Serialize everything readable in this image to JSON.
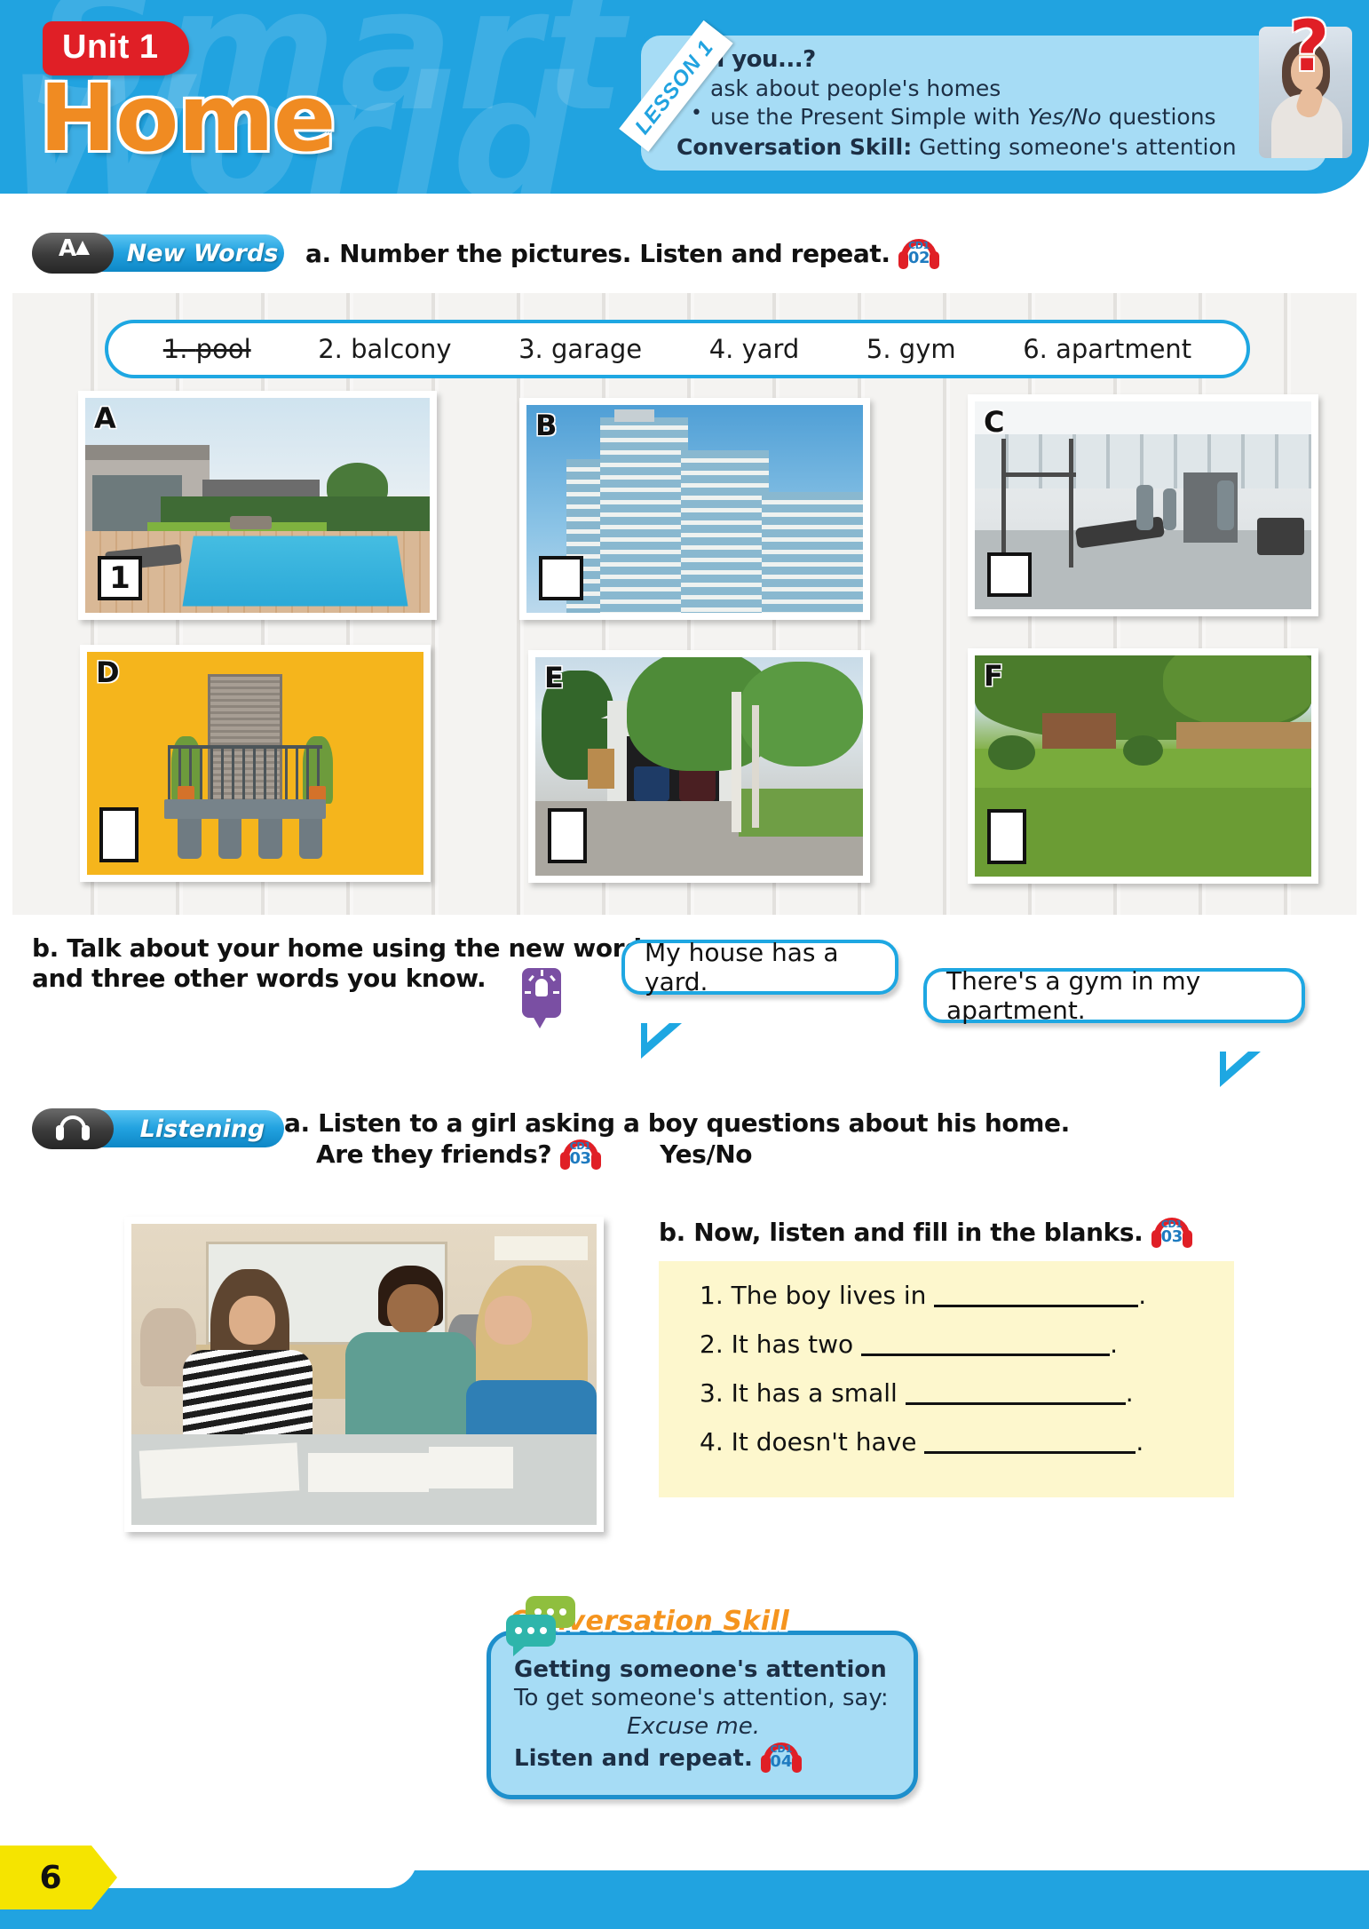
{
  "header": {
    "unit_label": "Unit 1",
    "unit_title": "Home",
    "ghost_text_1": "Smart",
    "ghost_text_2": "World",
    "lesson_tab": "LESSON 1",
    "can_you_title": "Can you...?",
    "can_you_items": [
      "ask about people's homes",
      "use the Present Simple with Yes/No questions"
    ],
    "conversation_skill_label": "Conversation Skill:",
    "conversation_skill_value": "Getting someone's attention",
    "question_mark": "?"
  },
  "new_words": {
    "badge_label": "New Words",
    "badge_icon": "word-list-icon",
    "instruction_a": "a. Number the pictures. Listen and repeat.",
    "cd_disc": "CD1",
    "cd_track": "02",
    "words": [
      {
        "num": "1.",
        "text": "pool",
        "struck": true
      },
      {
        "num": "2.",
        "text": "balcony",
        "struck": false
      },
      {
        "num": "3.",
        "text": "garage",
        "struck": false
      },
      {
        "num": "4.",
        "text": "yard",
        "struck": false
      },
      {
        "num": "5.",
        "text": "gym",
        "struck": false
      },
      {
        "num": "6.",
        "text": "apartment",
        "struck": false
      }
    ],
    "pictures": [
      {
        "letter": "A",
        "answer": "1",
        "subject": "pool"
      },
      {
        "letter": "B",
        "answer": "",
        "subject": "apartment"
      },
      {
        "letter": "C",
        "answer": "",
        "subject": "gym"
      },
      {
        "letter": "D",
        "answer": "",
        "subject": "balcony"
      },
      {
        "letter": "E",
        "answer": "",
        "subject": "garage"
      },
      {
        "letter": "F",
        "answer": "",
        "subject": "yard"
      }
    ],
    "instruction_b_line1": "b. Talk about your home using the new words",
    "instruction_b_line2": "and three other words you know.",
    "bubble_1": "My house has a yard.",
    "bubble_2": "There's a gym in my apartment."
  },
  "listening": {
    "badge_label": "Listening",
    "badge_icon": "headphones-icon",
    "instruction_a_line1": "a. Listen to a girl asking a boy questions about his home.",
    "instruction_a_line2": "Are they friends?",
    "answer_option": "Yes/No",
    "cd_a_disc": "CD1",
    "cd_a_track": "03",
    "instruction_b": "b. Now, listen and fill in the blanks.",
    "cd_b_disc": "CD1",
    "cd_b_track": "03",
    "blanks": [
      {
        "num": "1.",
        "text": "The boy lives in",
        "line_width": 230
      },
      {
        "num": "2.",
        "text": "It has two",
        "line_width": 280
      },
      {
        "num": "3.",
        "text": "It has a small",
        "line_width": 248
      },
      {
        "num": "4.",
        "text": "It doesn't have",
        "line_width": 238
      }
    ]
  },
  "conversation_skill": {
    "title": "Conversation Skill",
    "heading": "Getting someone's attention",
    "line1": "To get someone's attention, say:",
    "phrase": "Excuse me.",
    "line2": "Listen and repeat.",
    "cd_disc": "CD1",
    "cd_track": "04"
  },
  "footer": {
    "page_number": "6"
  },
  "colors": {
    "brand_blue": "#21a3e0",
    "light_blue": "#a6dcf5",
    "unit_red": "#e01f26",
    "title_orange": "#f08b22",
    "page_yellow": "#f5e400",
    "note_yellow": "#fdf7cd"
  }
}
